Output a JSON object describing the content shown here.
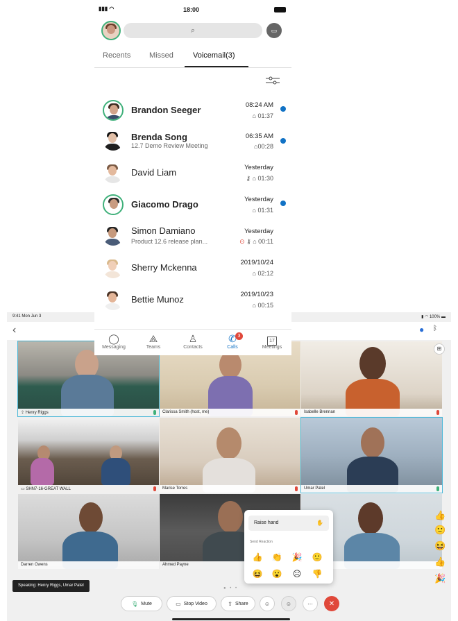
{
  "tablet": {
    "status_time": "9:41  Mon Jun 3",
    "status_right": "100%",
    "participants": [
      {
        "name": "Henry Riggs"
      },
      {
        "name": "Clarissa Smith (host, me)"
      },
      {
        "name": "Isabelle Brennan"
      },
      {
        "name": "SHN7-16-GREAT WALL"
      },
      {
        "name": "Marise Torres"
      },
      {
        "name": "Umar Patel"
      },
      {
        "name": "Darren Owens"
      },
      {
        "name": "Ahmed Payne"
      }
    ],
    "reaction_menu": {
      "raise_hand": "Raise hand",
      "send_reaction": "Send Reaction"
    },
    "speaking": "Speaking: Henry Riggs, Umar Patel",
    "controls": {
      "mute": "Mute",
      "stop_video": "Stop Video",
      "share": "Share"
    },
    "colors": {
      "active_border": "#4cb8d8",
      "end_call": "#e0483a",
      "mic_on": "#3fb07a"
    }
  },
  "phone": {
    "time": "18:00",
    "tabs": [
      "Recents",
      "Missed",
      "Voicemail(3)"
    ],
    "active_tab": "Voicemail(3)",
    "voicemails": [
      {
        "name": "Brandon Seeger",
        "subtitle": "",
        "when": "08:24 AM",
        "duration": "01:37",
        "unread": true
      },
      {
        "name": "Brenda Song",
        "subtitle": "12.7 Demo Review Meeting",
        "when": "06:35 AM",
        "duration": "00:28",
        "unread": true
      },
      {
        "name": "David Liam",
        "subtitle": "",
        "when": "Yesterday",
        "duration": "01:30",
        "unread": false
      },
      {
        "name": "Giacomo Drago",
        "subtitle": "",
        "when": "Yesterday",
        "duration": "01:31",
        "unread": true
      },
      {
        "name": "Simon Damiano",
        "subtitle": "Product 12.6 release plan...",
        "when": "Yesterday",
        "duration": "00:11",
        "unread": false
      },
      {
        "name": "Sherry Mckenna",
        "subtitle": "",
        "when": "2019/10/24",
        "duration": "02:12",
        "unread": false
      },
      {
        "name": "Bettie Munoz",
        "subtitle": "",
        "when": "2019/10/23",
        "duration": "00:15",
        "unread": false
      }
    ],
    "nav": [
      {
        "label": "Messaging",
        "icon": "chat-bubble-icon"
      },
      {
        "label": "Teams",
        "icon": "teams-icon"
      },
      {
        "label": "Contacts",
        "icon": "person-icon"
      },
      {
        "label": "Calls",
        "icon": "phone-icon",
        "badge": "3"
      },
      {
        "label": "Meetings",
        "icon": "calendar-icon",
        "day": "17"
      }
    ],
    "colors": {
      "unread_dot": "#1172c5",
      "ring": "#3fb07a",
      "active_nav": "#1172c5"
    }
  }
}
